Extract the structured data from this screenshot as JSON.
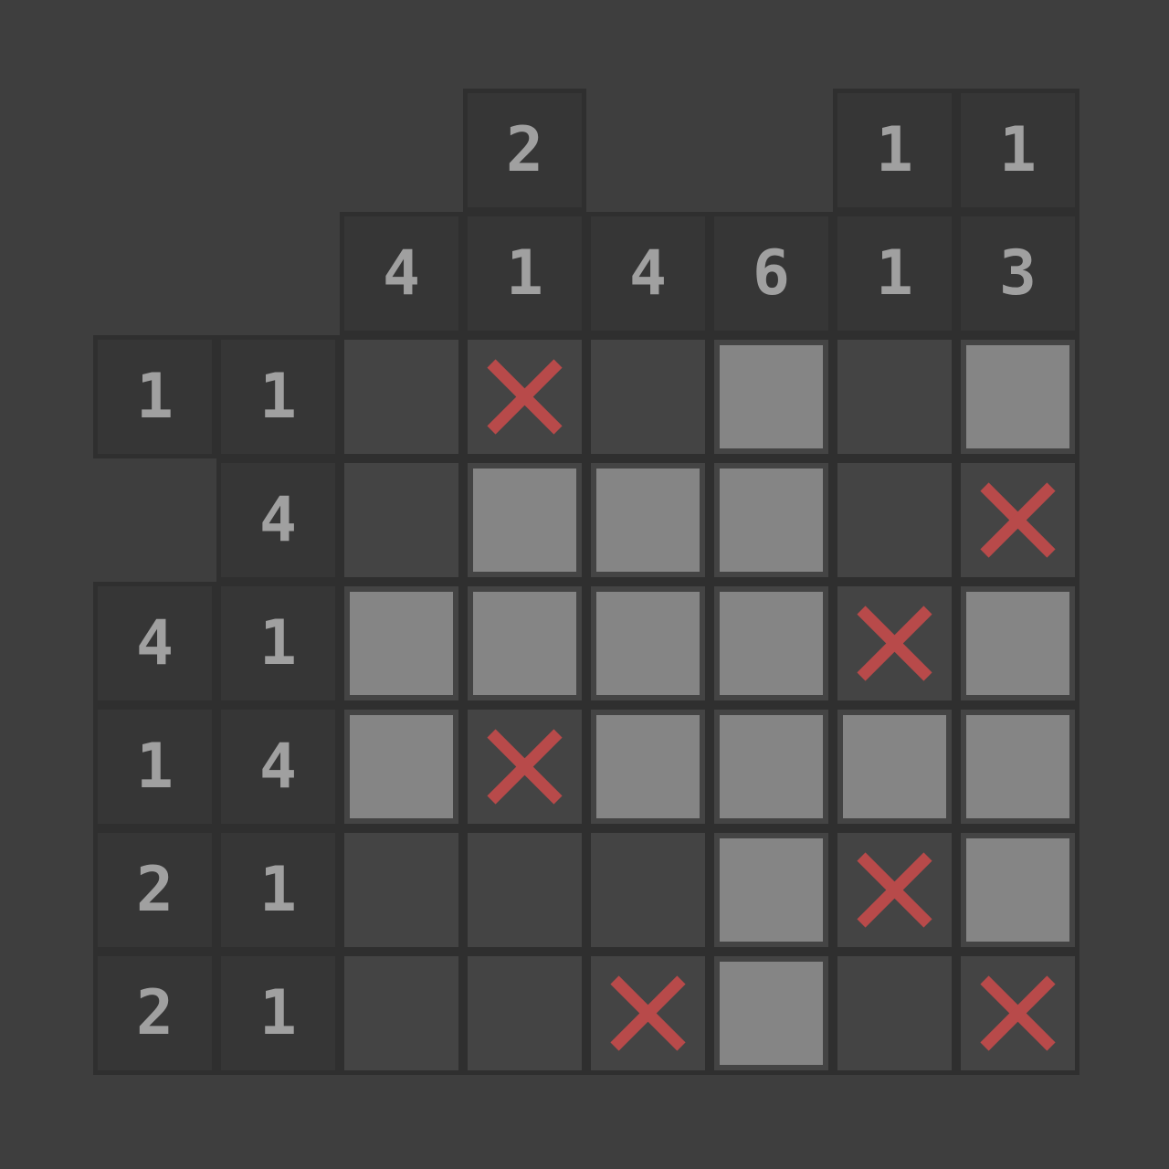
{
  "puzzle": {
    "columns": 8,
    "rows": 6,
    "column_clues": [
      [
        "4"
      ],
      [
        "2",
        "1"
      ],
      [
        "4"
      ],
      [
        "6"
      ],
      [
        "1",
        "1"
      ],
      [
        "1",
        "3"
      ]
    ],
    "row_clues": [
      [
        "1",
        "1"
      ],
      [
        "4"
      ],
      [
        "4",
        "1"
      ],
      [
        "1",
        "4"
      ],
      [
        "2",
        "1"
      ],
      [
        "2",
        "1"
      ]
    ],
    "grid": [
      [
        "empty",
        "cross",
        "empty",
        "filled",
        "empty",
        "filled"
      ],
      [
        "empty",
        "filled",
        "filled",
        "filled",
        "empty",
        "cross"
      ],
      [
        "filled",
        "filled",
        "filled",
        "filled",
        "cross",
        "filled"
      ],
      [
        "filled",
        "cross",
        "filled",
        "filled",
        "filled",
        "filled"
      ],
      [
        "empty",
        "empty",
        "empty",
        "filled",
        "cross",
        "filled"
      ],
      [
        "empty",
        "empty",
        "cross",
        "filled",
        "empty",
        "cross"
      ]
    ]
  },
  "colors": {
    "background": "#3e3e3e",
    "clue_bg": "#363636",
    "cell_bg": "#444444",
    "filled": "#858585",
    "cross": "#b84a4a",
    "clue_text": "#a0a0a0"
  },
  "icons": {
    "cross": "x-mark-icon"
  }
}
